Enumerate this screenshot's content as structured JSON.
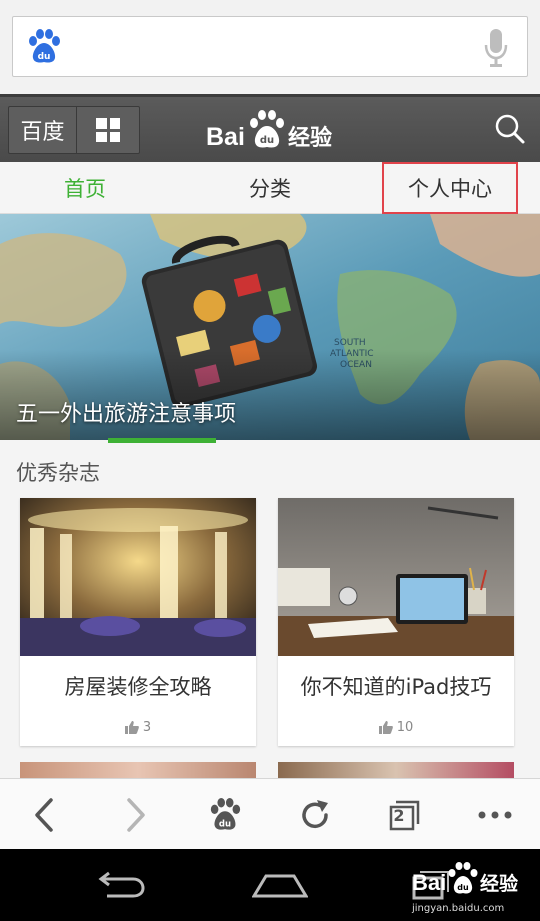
{
  "search": {
    "logo_icon": "baidu-paw-icon",
    "mic_icon": "microphone-icon",
    "placeholder": ""
  },
  "header": {
    "baidu_label": "百度",
    "apps_icon": "grid-icon",
    "brand_logo": "Baidu经验",
    "search_icon": "search-icon"
  },
  "tabs": [
    {
      "label": "首页",
      "active": true
    },
    {
      "label": "分类",
      "active": false
    },
    {
      "label": "个人中心",
      "active": false,
      "highlighted": true
    }
  ],
  "banner": {
    "title": "五一外出旅游注意事项",
    "map_labels": [
      "SOUTH",
      "ATLANTIC",
      "OCEAN"
    ]
  },
  "section": {
    "title": "优秀杂志"
  },
  "cards": [
    {
      "title": "房屋装修全攻略",
      "likes": "3",
      "like_icon": "thumbs-up-icon"
    },
    {
      "title": "你不知道的iPad技巧",
      "likes": "10",
      "like_icon": "thumbs-up-icon"
    }
  ],
  "toolbar": {
    "back_icon": "chevron-left-icon",
    "forward_icon": "chevron-right-icon",
    "home_icon": "baidu-paw-icon",
    "refresh_icon": "refresh-icon",
    "tabs_count": "2",
    "menu_icon": "more-dots-icon"
  },
  "navbar": {
    "back_icon": "android-back-icon",
    "home_icon": "android-home-icon",
    "recents_icon": "android-recents-icon"
  },
  "watermark": {
    "logo": "Baidu经验",
    "url": "jingyan.baidu.com"
  },
  "colors": {
    "accent_green": "#3eb135",
    "highlight_red": "#e1434b",
    "baidu_blue": "#2f6fe0",
    "header_gray": "#525252"
  }
}
